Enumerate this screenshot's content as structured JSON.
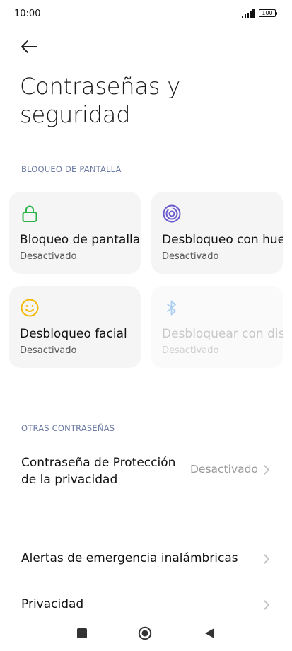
{
  "status": {
    "time": "10:00",
    "battery": "100"
  },
  "header": {
    "title": "Contraseñas y seguridad"
  },
  "sections": {
    "screen_lock": "BLOQUEO DE PANTALLA",
    "other_passwords": "OTRAS CONTRASEÑAS"
  },
  "cards": [
    {
      "title": "Bloqueo de pantalla",
      "subtitle": "Desactivado",
      "icon": "lock-icon",
      "color": "#2bb34a"
    },
    {
      "title": "Desbloqueo con huella",
      "subtitle": "Desactivado",
      "icon": "fingerprint-icon",
      "color": "#6a5acd"
    },
    {
      "title": "Desbloqueo facial",
      "subtitle": "Desactivado",
      "icon": "smiley-face-icon",
      "color": "#f5b800"
    },
    {
      "title": "Desbloquear con dispositivo Bluetooth",
      "subtitle": "Desactivado",
      "icon": "bluetooth-icon",
      "color": "#a9cdf0"
    }
  ],
  "rows": {
    "privacy_password": {
      "label": "Contraseña de Protección de la privacidad",
      "value": "Desactivado"
    },
    "emergency_alerts": {
      "label": "Alertas de emergencia inalámbricas"
    },
    "privacy": {
      "label": "Privacidad"
    }
  }
}
